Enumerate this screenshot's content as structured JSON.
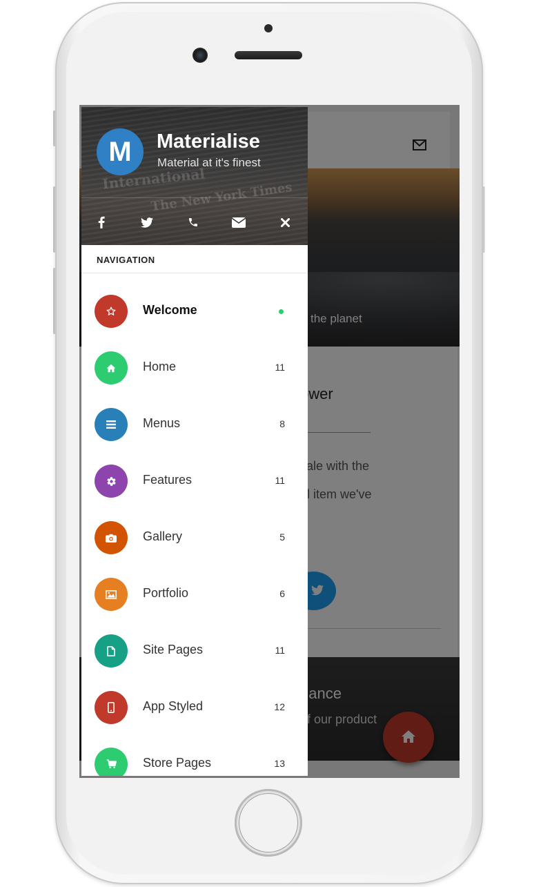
{
  "drawer": {
    "brand_title": "Materialise",
    "brand_subtitle": "Material at it's finest",
    "logo_letter": "M",
    "nav_heading": "NAVIGATION",
    "social_icons": [
      "facebook-icon",
      "twitter-icon",
      "phone-icon",
      "envelope-icon",
      "close-icon"
    ],
    "items": [
      {
        "label": "Welcome",
        "icon": "star-icon",
        "color": "#c0392b",
        "count": "",
        "active": true
      },
      {
        "label": "Home",
        "icon": "home-icon",
        "color": "#2ecc71",
        "count": "11"
      },
      {
        "label": "Menus",
        "icon": "bars-icon",
        "color": "#2980b9",
        "count": "8"
      },
      {
        "label": "Features",
        "icon": "gear-icon",
        "color": "#8e44ad",
        "count": "11"
      },
      {
        "label": "Gallery",
        "icon": "camera-icon",
        "color": "#d35400",
        "count": "5"
      },
      {
        "label": "Portfolio",
        "icon": "image-icon",
        "color": "#e67e22",
        "count": "6"
      },
      {
        "label": "Site Pages",
        "icon": "file-icon",
        "color": "#16a085",
        "count": "11"
      },
      {
        "label": "App Styled",
        "icon": "mobile-icon",
        "color": "#c0392b",
        "count": "12"
      },
      {
        "label": "Store Pages",
        "icon": "cart-icon",
        "color": "#2ecc71",
        "count": "13"
      }
    ]
  },
  "background_page": {
    "hero_text": "the planet",
    "card_title": "ower",
    "card_line1": "sale with the",
    "card_line2": "ul item we've",
    "dark_title": "nance",
    "dark_subtitle": "of our product"
  }
}
